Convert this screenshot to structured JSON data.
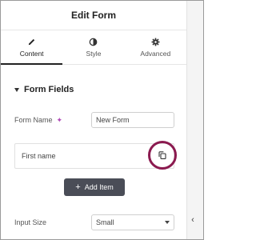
{
  "header": {
    "title": "Edit Form"
  },
  "tabs": [
    {
      "label": "Content",
      "icon": "pencil-icon",
      "active": true
    },
    {
      "label": "Style",
      "icon": "contrast-icon",
      "active": false
    },
    {
      "label": "Advanced",
      "icon": "gear-icon",
      "active": false
    }
  ],
  "section": {
    "title": "Form Fields",
    "expanded": true
  },
  "form_name": {
    "label": "Form Name",
    "ai_icon": "sparkle-icon",
    "value": "New Form"
  },
  "fields": [
    {
      "label": "First name"
    }
  ],
  "actions": {
    "duplicate_icon": "copy-icon",
    "add_item_label": "Add Item"
  },
  "input_size": {
    "label": "Input Size",
    "value": "Small"
  },
  "colors": {
    "highlight": "#8b1a4f",
    "button_bg": "#4a4d57",
    "ai_accent": "#b04ab8"
  }
}
